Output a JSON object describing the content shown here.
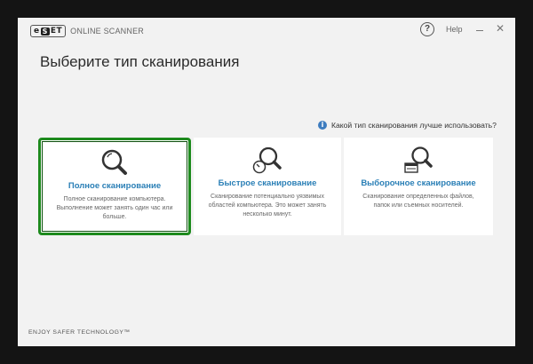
{
  "window": {
    "brand": "ESET",
    "product": "ONLINE SCANNER",
    "help_label": "Help"
  },
  "page": {
    "title": "Выберите тип сканирования",
    "info_link": "Какой тип сканирования лучше использовать?",
    "footer": "ENJOY SAFER TECHNOLOGY™"
  },
  "colors": {
    "accent": "#2a7fb6",
    "selected_border": "#1d8a1d",
    "window_bg": "#f2f2f2",
    "info_icon": "#3d7cbf"
  },
  "cards": [
    {
      "icon": "magnifier-icon",
      "title": "Полное сканирование",
      "description": "Полное сканирование компьютера. Выполнение может занять один час или больше.",
      "selected": true
    },
    {
      "icon": "magnifier-clock-icon",
      "title": "Быстрое сканирование",
      "description": "Сканирование потенциально уязвимых областей компьютера. Это может занять несколько минут.",
      "selected": false
    },
    {
      "icon": "magnifier-window-icon",
      "title": "Выборочное сканирование",
      "description": "Сканирование определенных файлов, папок или съемных носителей.",
      "selected": false
    }
  ]
}
